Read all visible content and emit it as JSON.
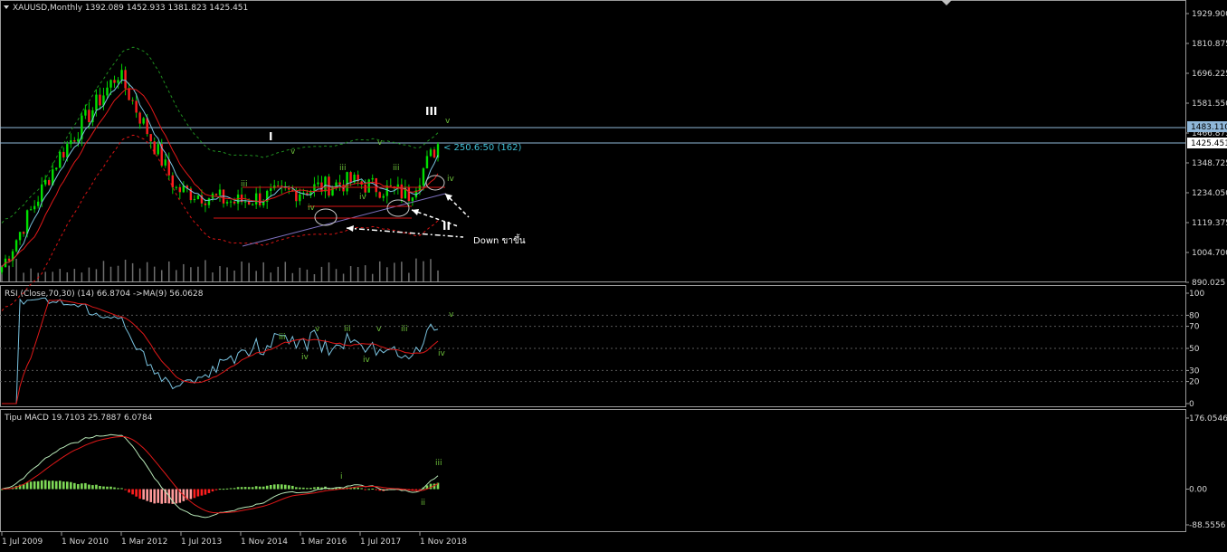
{
  "colors": {
    "bg": "#000000",
    "frame": "#9a9a9a",
    "bull": "#00e000",
    "bear": "#ff1e1e",
    "wick": "#00cc00",
    "blue": "#7ac3e0",
    "red": "#e01818",
    "green": "#4caf2d",
    "dash_green": "#1f8f1f",
    "dash_red": "#d81414",
    "white": "#ffffff",
    "hline_val": "#8fb7d9",
    "lime": "#7ed957"
  },
  "main": {
    "header": "XAUUSD,Monthly  1392.089 1452.933 1381.823 1425.451",
    "menu_icon": "triangle-down-icon",
    "price_ticks": [
      "1929.900",
      "1810.875",
      "1696.225",
      "1581.550",
      "1466.875",
      "1348.725",
      "1234.050",
      "1119.375",
      "1004.700",
      "890.025"
    ],
    "hline_value": "1483.110",
    "current_price": "1425.451",
    "fib_label": "< 250.6:50 (162)",
    "annotation": "Down ขาขึ้น",
    "wave_labels": {
      "w1": "I",
      "w2": "II",
      "w3": "III",
      "v": "v",
      "iv": "iv",
      "iii": "iii"
    }
  },
  "rsi": {
    "header": "RSI (Close,70,30) (14) 66.8704  ->MA(9) 56.0628",
    "ticks": [
      "100",
      "80",
      "70",
      "50",
      "30",
      "20",
      "0"
    ]
  },
  "macd": {
    "header": "Tipu MACD 19.7103 25.7887 6.0784",
    "ticks": [
      "176.0546",
      "0.00",
      "-88.5556"
    ],
    "wave_labels": {
      "i": "i",
      "iii": "iii",
      "ii": "ii"
    }
  },
  "x_ticks": [
    "1 Jul 2009",
    "1 Nov 2010",
    "1 Mar 2012",
    "1 Jul 2013",
    "1 Nov 2014",
    "1 Mar 2016",
    "1 Jul 2017",
    "1 Nov 2018"
  ],
  "chart_data": {
    "type": "line",
    "ylim": [
      890.025,
      1929.9
    ],
    "x": [
      2009.5,
      2010.83,
      2012.17,
      2013.5,
      2014.83,
      2016.17,
      2017.5,
      2018.83,
      2019.5
    ],
    "series": [
      {
        "values": [
          950,
          1380,
          1700,
          1250,
          1200,
          1240,
          1280,
          1230,
          1425
        ]
      }
    ]
  }
}
